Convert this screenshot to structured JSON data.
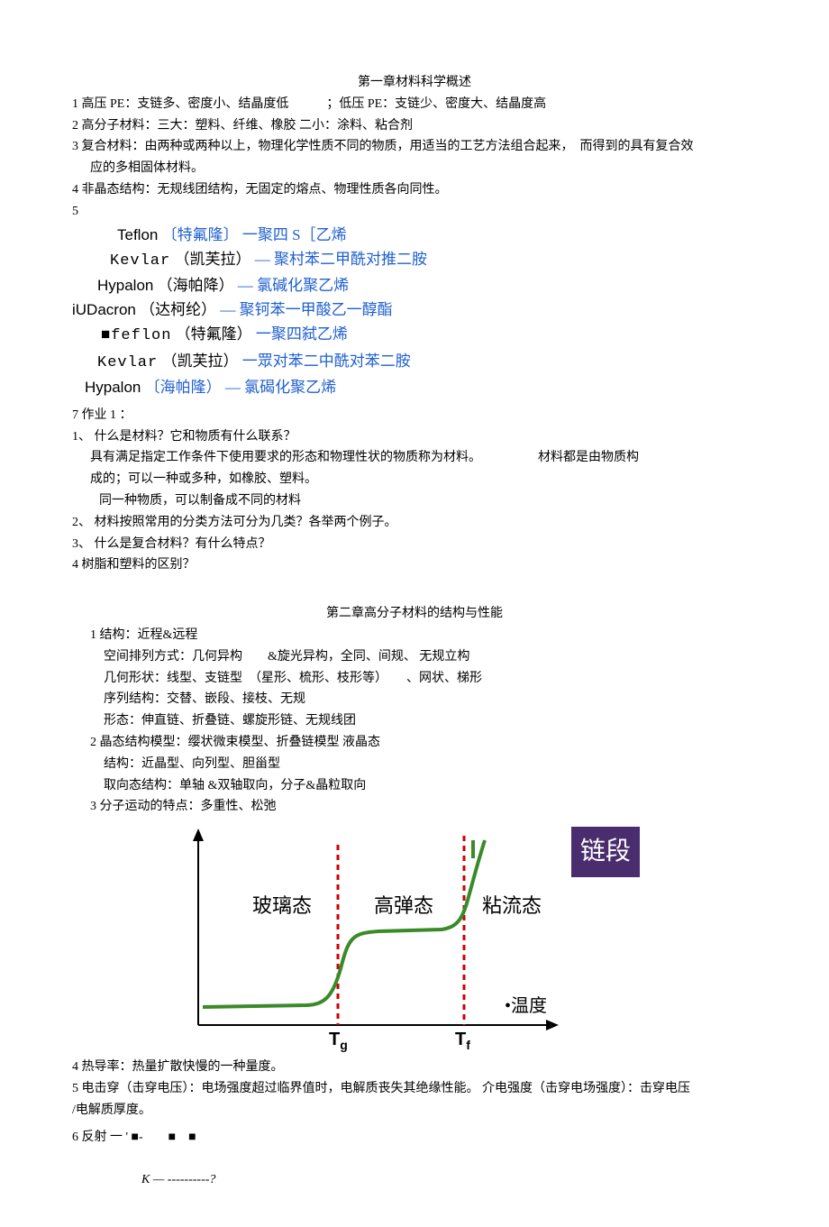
{
  "ch1": {
    "title": "第一章材料科学概述",
    "p1": "1 高压 PE：支链多、密度小、结晶度低　　　；低压 PE：支链少、密度大、结晶度高",
    "p2": "2 高分子材料：三大：塑料、纤维、橡胶 二小：涂料、粘合剂",
    "p3a": "3 复合材料：由两种或两种以上，物理化学性质不同的物质，用适当的工艺方法组合起来，　而得到的具有复合效",
    "p3b": "应的多相固体材料。",
    "p4": "4 非晶态结构：无规线团结构，无固定的熔点、物理性质各向同性。",
    "p5": "5",
    "teflon1_a": "Teflon",
    "teflon1_b": "〔特氟隆〕",
    "teflon1_c": "一聚四 S［乙烯",
    "kevlar1_a": "Kevlar",
    "kevlar1_b": "（凯芙拉）",
    "kevlar1_c": "— 聚村苯二甲酰对推二胺",
    "hypalon1_a": "Hypalon",
    "hypalon1_b": "（海帕降）",
    "hypalon1_c": "— 氯碱化聚乙烯",
    "dacron_a": "iUDacron",
    "dacron_b": "（达柯纶）",
    "dacron_c": "— 聚钶苯一甲酸乙一醇酯",
    "teflon2_a": "■feflon",
    "teflon2_b": "（特氟隆）",
    "teflon2_c": "一聚四弑乙烯",
    "kevlar2_a": "Kevlar",
    "kevlar2_b": "（凯芙拉）",
    "kevlar2_c": "一眾对苯二中酰对苯二胺",
    "hypalon2_a": "Hypalon",
    "hypalon2_b": "〔海帕隆）",
    "hypalon2_c": "— 氯碣化聚乙烯",
    "p7": "7 作业 1 ：",
    "q1": "1、 什么是材料？它和物质有什么联系？",
    "q1a": "具有满足指定工作条件下使用要求的形态和物理性状的物质称为材料。　　　　　材料都是由物质构",
    "q1b": "成的；可以一种或多种，如橡胶、塑料。",
    "q1c": "同一种物质，可以制备成不同的材料",
    "q2": "2、 材料按照常用的分类方法可分为几类？各举两个例子。",
    "q3": "3、 什么是复合材料？有什么特点？",
    "q4": "4 树脂和塑料的区别？"
  },
  "ch2": {
    "title": "第二章高分子材料的结构与性能",
    "s1": "1 结构：近程&远程",
    "s1a": "空间排列方式：几何异构　　&旋光异构，全同、间规、 无规立构",
    "s1b": "几何形状：线型、支链型　（星形、梳形、枝形等）　　、网状、梯形",
    "s1c": "序列结构：交替、嵌段、接枝、无规",
    "s1d": "形态：伸直链、折叠链、螺旋形链、无规线团",
    "s2": "2 晶态结构模型：缨状微束模型、折叠链模型 液晶态",
    "s2a": "结构：近晶型、向列型、胆甾型",
    "s2b": "取向态结构：单轴 &双轴取向，分子&晶粒取向",
    "s3": "3 分子运动的特点：多重性、松弛",
    "badge": "链段",
    "state1": "玻璃态",
    "state2": "高弹态",
    "state3": "粘流态",
    "temp": "•温度",
    "tg": "T",
    "tg_sub": "g",
    "tf": "T",
    "tf_sub": "f",
    "s4": "4 热导率：热量扩散快慢的一种量度。",
    "s5a": "5 电击穿（击穿电压）：电场强度超过临界值时，电解质丧失其绝缘性能。 介电强度（击穿电场强度）：击穿电压",
    "s5b": "/电解质厚度。",
    "s6a": "6 反射 一 ' ■-　　■　■",
    "s6b": "K — ----------?"
  },
  "chart_data": {
    "type": "line",
    "title": "分子运动的特点",
    "xlabel": "温度",
    "ylabel": "",
    "annotations": [
      "玻璃态",
      "高弹态",
      "粘流态",
      "链段"
    ],
    "vlines": [
      "Tg",
      "Tf"
    ],
    "series": [
      {
        "name": "curve",
        "x": [
          0,
          25,
          30,
          34,
          38,
          40,
          42,
          55,
          58,
          60,
          62,
          64,
          66,
          70
        ],
        "y": [
          10,
          10,
          11,
          15,
          35,
          48,
          50,
          51,
          54,
          62,
          80,
          100,
          120,
          140
        ]
      }
    ]
  }
}
